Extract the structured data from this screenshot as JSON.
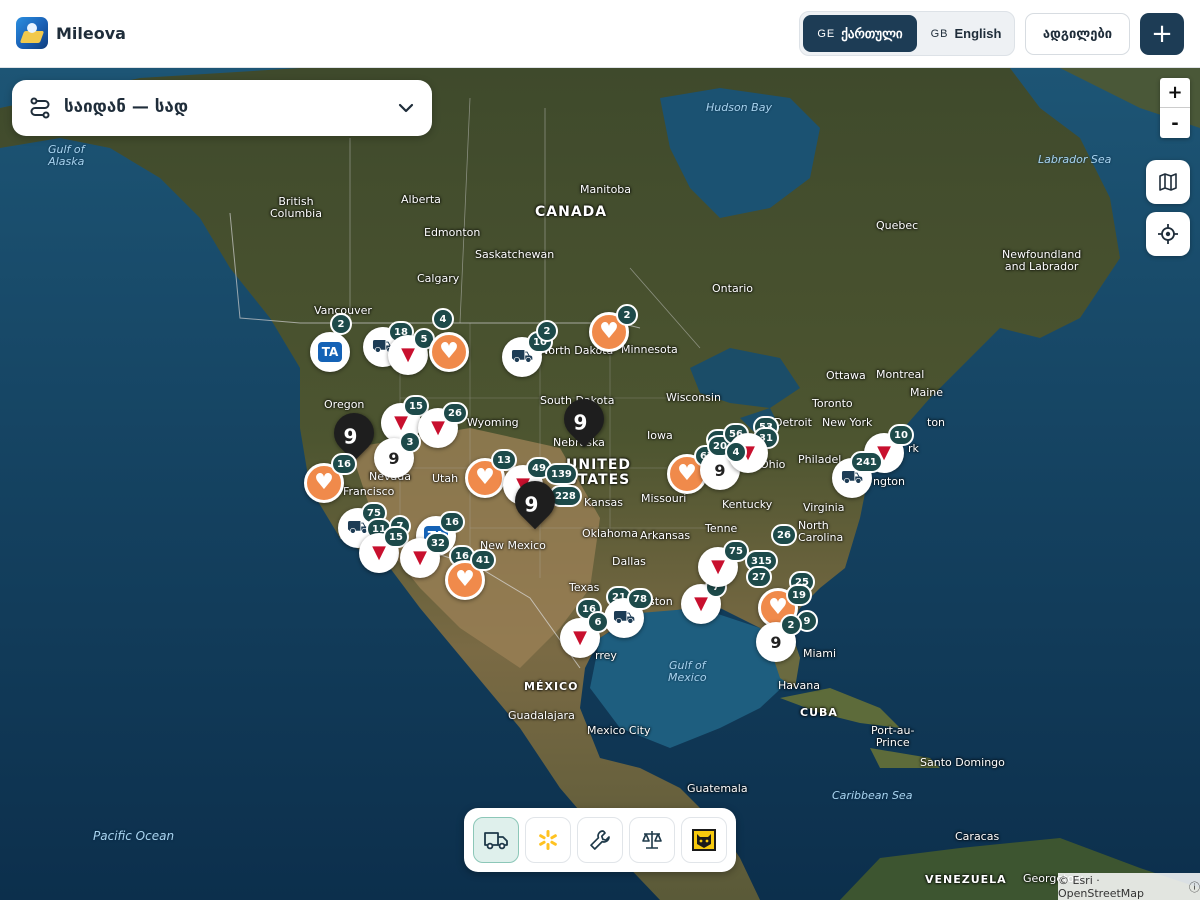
{
  "header": {
    "app_name": "Mileova",
    "lang_ka": {
      "flag": "GE",
      "label": "ქართული",
      "active": true
    },
    "lang_en": {
      "flag": "GB",
      "label": "English",
      "active": false
    },
    "places_label": "ადგილები",
    "add_label": "+"
  },
  "route": {
    "title": "საიდან — სად"
  },
  "zoom": {
    "in": "+",
    "out": "-"
  },
  "controls": {
    "layers_icon": "map-icon",
    "locate_icon": "locate-icon"
  },
  "toolbar": {
    "tools": [
      {
        "name": "truck-filter",
        "icon": "truck-icon",
        "active": true
      },
      {
        "name": "walmart-filter",
        "icon": "walmart-spark-icon",
        "active": false
      },
      {
        "name": "repair-filter",
        "icon": "wrench-icon",
        "active": false
      },
      {
        "name": "scale-filter",
        "icon": "scale-icon",
        "active": false
      },
      {
        "name": "cat-filter",
        "icon": "cat-logo-icon",
        "active": false
      }
    ]
  },
  "attribution": {
    "text": "© Esri · OpenStreetMap",
    "info": "ⓘ"
  },
  "map_labels": {
    "hudson_bay": "Hudson Bay",
    "labrador_sea": "Labrador Sea",
    "gulf_alaska": "Gulf of\nAlaska",
    "canada": "CANADA",
    "british_columbia": "British\nColumbia",
    "alberta": "Alberta",
    "manitoba": "Manitoba",
    "edmonton": "Edmonton",
    "saskatchewan": "Saskatchewan",
    "calgary": "Calgary",
    "ontario": "Ontario",
    "quebec": "Quebec",
    "newfoundland": "Newfoundland\nand Labrador",
    "vancouver": "Vancouver",
    "oregon": "Oregon",
    "wyoming": "Wyoming",
    "north_dakota": "North Dakota",
    "minnesota": "Minnesota",
    "south_dakota": "South Dakota",
    "wisconsin": "Wisconsin",
    "nebraska": "Nebraska",
    "iowa": "Iowa",
    "united_states": "UNITED\nSTATES",
    "kansas": "Kansas",
    "missouri": "Missouri",
    "utah": "Utah",
    "nevada": "Nevada",
    "francisco": "Francisco",
    "ottawa": "Ottawa",
    "montreal": "Montreal",
    "maine": "Maine",
    "toronto": "Toronto",
    "detroit": "Detroit",
    "new_york": "New York",
    "ohio": "Ohio",
    "philadelphia": "Philadel",
    "washington": "ngton",
    "kentucky": "Kentucky",
    "virginia": "Virginia",
    "north_carolina": "North\nCarolina",
    "tennessee": "Tenne",
    "arkansas": "Arkansas",
    "oklahoma": "Oklahoma",
    "new_mexico": "New Mexico",
    "dallas": "Dallas",
    "texas": "Texas",
    "houston": "ston",
    "monterrey": "rrey",
    "mexico": "MÉXICO",
    "guadalajara": "Guadalajara",
    "mexico_city": "Mexico City",
    "gulf_mexico": "Gulf of\nMexico",
    "miami": "Miami",
    "havana": "Havana",
    "cuba": "CUBA",
    "port_au_prince": "Port-au-\nPrince",
    "santo_domingo": "Santo Domingo",
    "caribbean_sea": "Caribbean Sea",
    "guatemala": "Guatemala",
    "caracas": "Caracas",
    "venezuela": "VENEZUELA",
    "georgetown": "Georgetow",
    "pacific_ocean": "Pacific Ocean",
    "ton": "ton",
    "rk": "rk"
  },
  "cluster_counts": [
    "2",
    "18",
    "4",
    "5",
    "10",
    "2",
    "2",
    "15",
    "26",
    "3",
    "16",
    "13",
    "49",
    "139",
    "228",
    "67",
    "49",
    "20",
    "56",
    "53",
    "31",
    "4",
    "10",
    "241",
    "75",
    "11",
    "7",
    "15",
    "16",
    "32",
    "16",
    "41",
    "16",
    "21",
    "78",
    "6",
    "7",
    "75",
    "315",
    "27",
    "26",
    "25",
    "19",
    "9",
    "2"
  ]
}
